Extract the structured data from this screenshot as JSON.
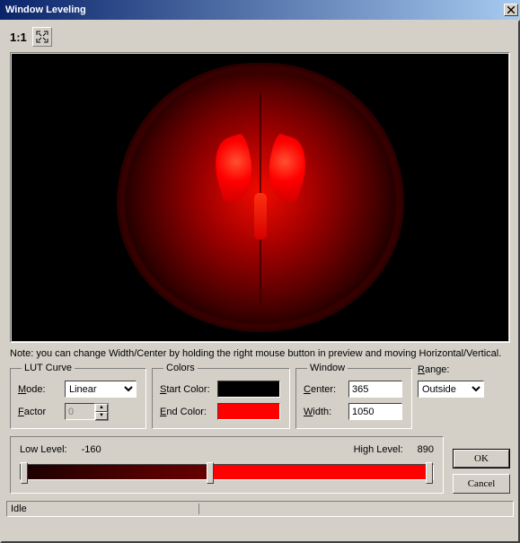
{
  "window": {
    "title": "Window Leveling"
  },
  "toolbar": {
    "zoom_label": "1:1"
  },
  "note": "Note: you can change Width/Center by holding the right mouse button in preview and moving Horizontal/Vertical.",
  "lut": {
    "legend": "LUT Curve",
    "mode_label": "Mode:",
    "mode_underline": "M",
    "mode_value": "Linear",
    "mode_options": [
      "Linear"
    ],
    "factor_label": "Factor",
    "factor_underline": "F",
    "factor_value": "0"
  },
  "colors": {
    "legend": "Colors",
    "start_label": "Start Color:",
    "start_underline": "S",
    "start_hex": "#000000",
    "end_label": "End Color:",
    "end_underline": "E",
    "end_hex": "#ff0000"
  },
  "window_group": {
    "legend": "Window",
    "center_label": "Center:",
    "center_underline": "C",
    "center_value": "365",
    "width_label": "Width:",
    "width_underline": "W",
    "width_value": "1050"
  },
  "range": {
    "label": "Range:",
    "underline": "R",
    "value": "Outside",
    "options": [
      "Outside"
    ]
  },
  "levels": {
    "low_label": "Low Level:",
    "low_value": "-160",
    "high_label": "High Level:",
    "high_value": "890"
  },
  "buttons": {
    "ok": "OK",
    "cancel": "Cancel"
  },
  "status": {
    "text": "Idle"
  }
}
